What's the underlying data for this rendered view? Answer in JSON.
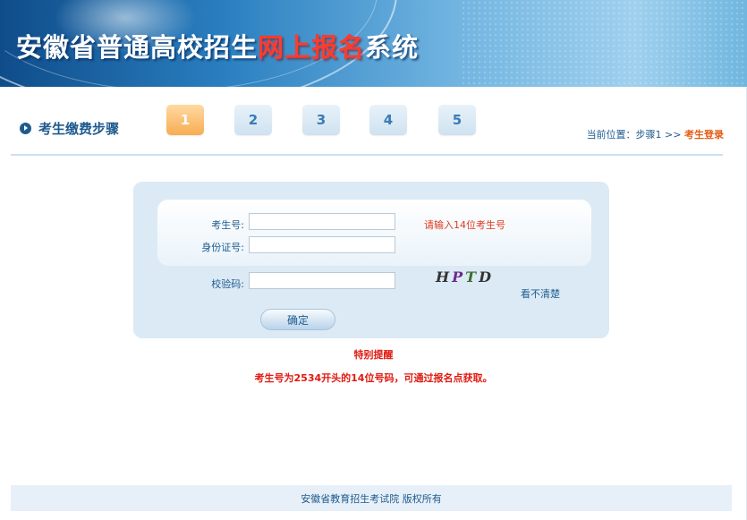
{
  "banner": {
    "title_part1": "安徽省普通高校招生",
    "title_highlight": "网上报名",
    "title_part2": "系统"
  },
  "steps": {
    "title": "考生缴费步骤",
    "items": [
      {
        "label": "1",
        "active": true
      },
      {
        "label": "2",
        "active": false
      },
      {
        "label": "3",
        "active": false
      },
      {
        "label": "4",
        "active": false
      },
      {
        "label": "5",
        "active": false
      }
    ],
    "location_prefix": "当前位置：步骤1 >> ",
    "location_current": "考生登录"
  },
  "form": {
    "exam_no_label": "考生号:",
    "exam_no_value": "",
    "exam_no_hint": "请输入14位考生号",
    "id_label": "身份证号:",
    "id_value": "",
    "verify_label": "校验码:",
    "verify_value": "",
    "captcha": {
      "c1": "H",
      "c2": "P",
      "c3": "T",
      "c4": "D"
    },
    "refresh_label": "看不清楚",
    "confirm_label": "确定"
  },
  "notice": {
    "title": "特别提醒",
    "text": "考生号为2534开头的14位号码，可通过报名点获取。"
  },
  "footer": {
    "text": "安徽省教育招生考试院 版权所有"
  },
  "colors": {
    "primary": "#1e5b8e",
    "accent_red": "#e01a10",
    "step_active": "#f7ad52",
    "panel_bg": "#dceaf5"
  }
}
